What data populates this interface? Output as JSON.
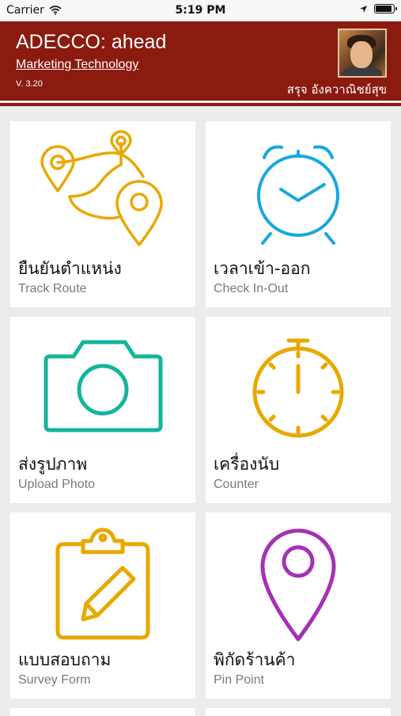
{
  "status_bar": {
    "carrier": "Carrier",
    "time": "5:19 PM",
    "battery_level": 0.9
  },
  "header": {
    "title": "ADECCO: ahead",
    "subtitle": "Marketing Technology",
    "version": "V. 3.20",
    "user_name": "สรุจ อังควาณิชย์สุข"
  },
  "menu": [
    {
      "thai": "ยืนยันตำแหน่ง",
      "english": "Track Route",
      "icon": "route-pins-icon",
      "color": "#e8a800"
    },
    {
      "thai": "เวลาเข้า-ออก",
      "english": "Check In-Out",
      "icon": "alarm-clock-icon",
      "color": "#1aa6e0"
    },
    {
      "thai": "ส่งรูปภาพ",
      "english": "Upload Photo",
      "icon": "camera-icon",
      "color": "#13b59b"
    },
    {
      "thai": "เครื่องนับ",
      "english": "Counter",
      "icon": "stopwatch-icon",
      "color": "#e8a800"
    },
    {
      "thai": "แบบสอบถาม",
      "english": "Survey Form",
      "icon": "clipboard-pencil-icon",
      "color": "#e8a800"
    },
    {
      "thai": "พิกัดร้านค้า",
      "english": "Pin Point",
      "icon": "map-pin-icon",
      "color": "#a531b5"
    }
  ]
}
